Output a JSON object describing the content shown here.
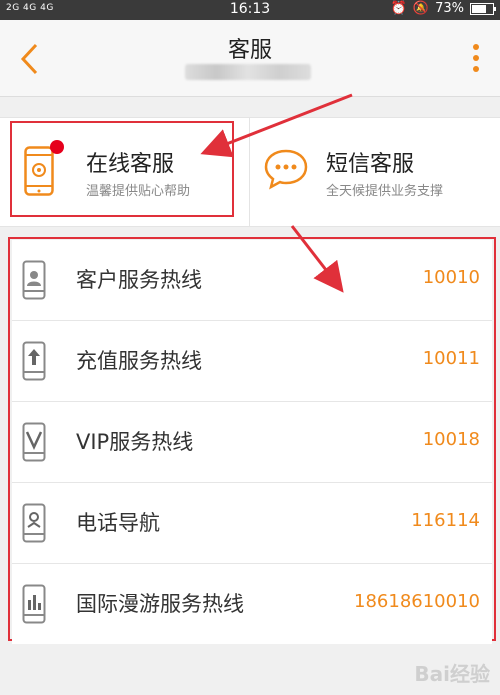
{
  "status_bar": {
    "network": "2G 4G 4G",
    "time": "16:13",
    "battery": "73%"
  },
  "nav": {
    "title": "客服"
  },
  "cards": [
    {
      "title": "在线客服",
      "desc": "温馨提供贴心帮助",
      "icon": "phone-icon"
    },
    {
      "title": "短信客服",
      "desc": "全天候提供业务支撑",
      "icon": "chat-icon"
    }
  ],
  "hotlines": [
    {
      "label": "客户服务热线",
      "number": "10010",
      "icon": "person-phone-icon"
    },
    {
      "label": "充值服务热线",
      "number": "10011",
      "icon": "upload-phone-icon"
    },
    {
      "label": "VIP服务热线",
      "number": "10018",
      "icon": "vip-phone-icon"
    },
    {
      "label": "电话导航",
      "number": "116114",
      "icon": "navigation-phone-icon"
    },
    {
      "label": "国际漫游服务热线",
      "number": "18618610010",
      "icon": "roaming-phone-icon"
    }
  ],
  "colors": {
    "accent": "#f08a1c",
    "annotation": "#e0303a",
    "badge": "#e6001c"
  },
  "watermark": "Bai经验"
}
